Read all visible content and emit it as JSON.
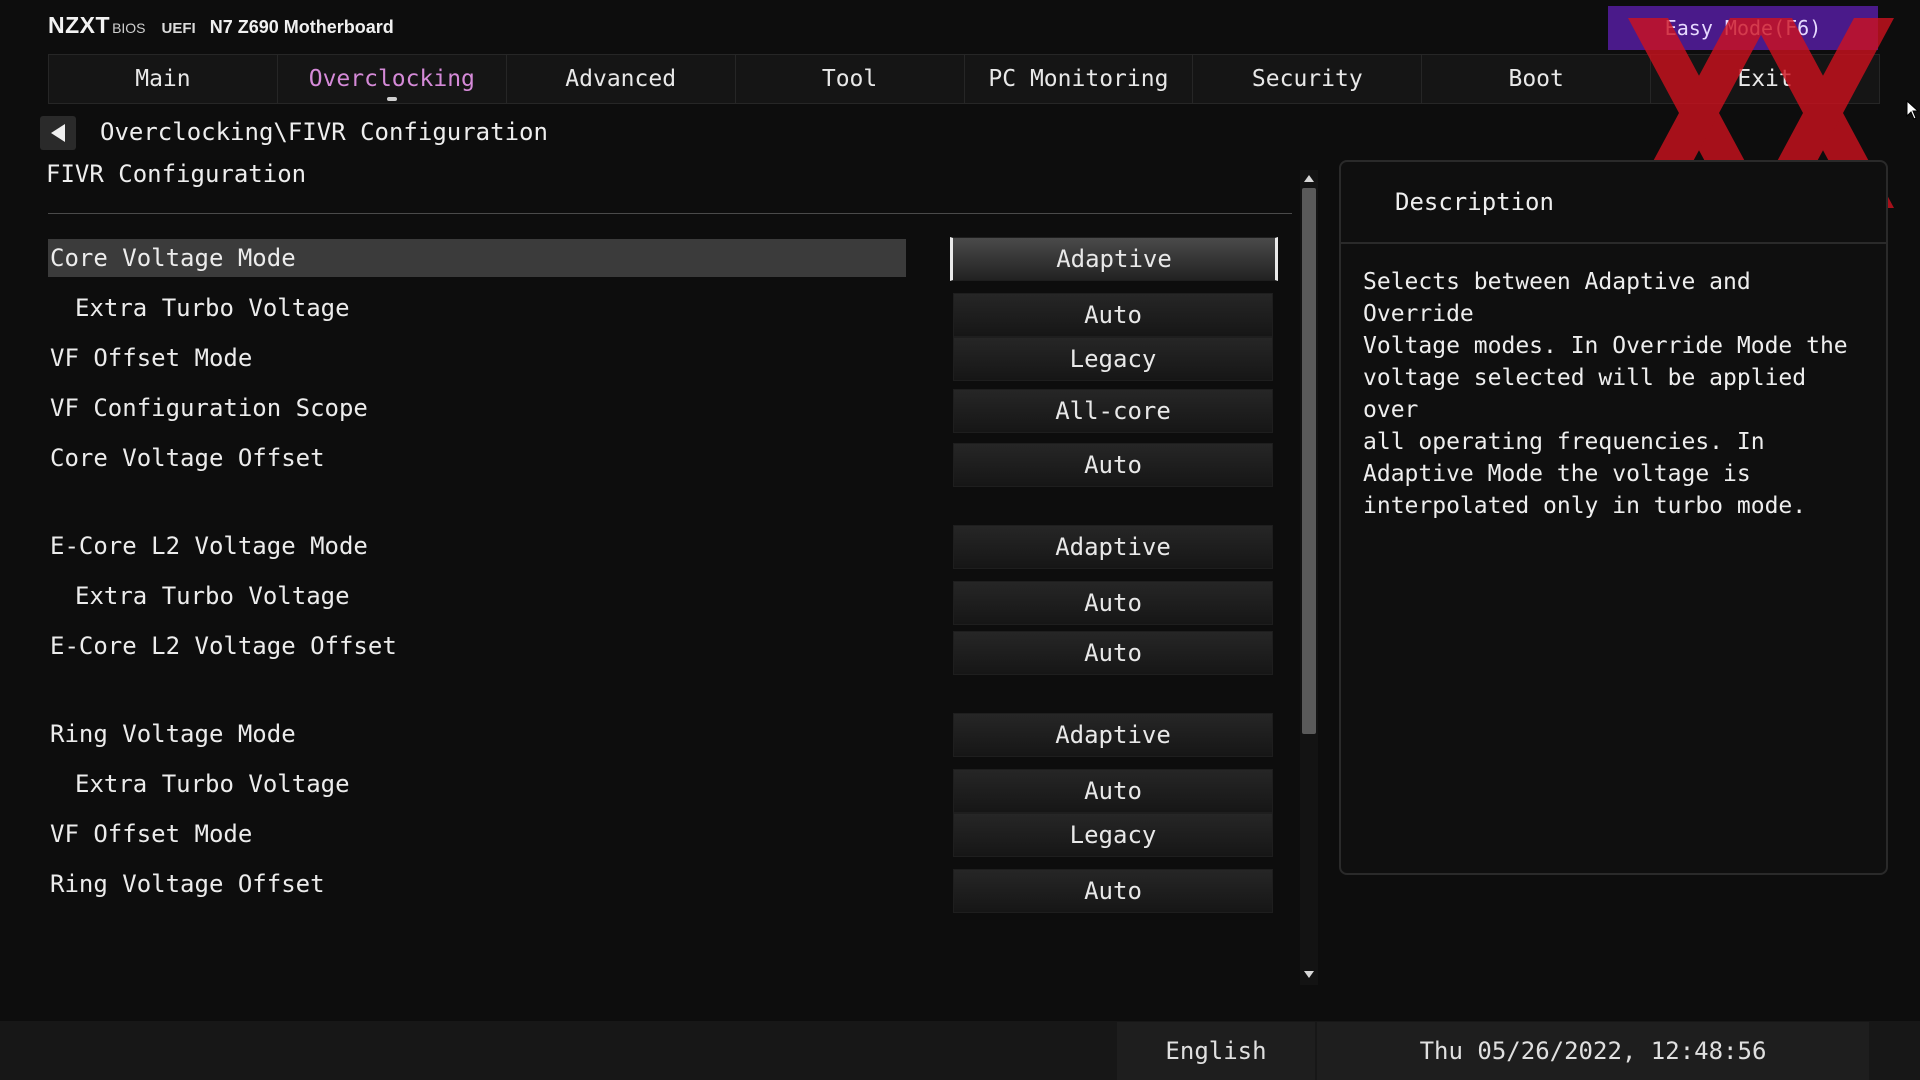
{
  "header": {
    "logo": "NZXT",
    "bios": "BIOS",
    "uefi": "UEFI",
    "board": "N7 Z690 Motherboard",
    "easy_mode": "Easy Mode(F6)"
  },
  "tabs": [
    {
      "label": "Main"
    },
    {
      "label": "Overclocking",
      "active": true
    },
    {
      "label": "Advanced"
    },
    {
      "label": "Tool"
    },
    {
      "label": "PC Monitoring"
    },
    {
      "label": "Security"
    },
    {
      "label": "Boot"
    },
    {
      "label": "Exit"
    }
  ],
  "breadcrumb": "Overclocking\\FIVR Configuration",
  "section_title": "FIVR Configuration",
  "settings": [
    {
      "label": "Core Voltage Mode",
      "value": "Adaptive",
      "selected": true,
      "indent": false
    },
    {
      "label": "Extra Turbo Voltage",
      "value": "Auto",
      "selected": false,
      "indent": true
    },
    {
      "label": "VF Offset Mode",
      "value": "Legacy",
      "selected": false,
      "indent": false
    },
    {
      "label": "VF Configuration Scope",
      "value": "All-core",
      "selected": false,
      "indent": false
    },
    {
      "label": "Core Voltage Offset",
      "value": "Auto",
      "selected": false,
      "indent": false
    },
    {
      "label": "E-Core L2 Voltage Mode",
      "value": "Adaptive",
      "selected": false,
      "indent": false
    },
    {
      "label": "Extra Turbo Voltage",
      "value": "Auto",
      "selected": false,
      "indent": true
    },
    {
      "label": "E-Core L2 Voltage Offset",
      "value": "Auto",
      "selected": false,
      "indent": false
    },
    {
      "label": "Ring Voltage Mode",
      "value": "Adaptive",
      "selected": false,
      "indent": false
    },
    {
      "label": "Extra Turbo Voltage",
      "value": "Auto",
      "selected": false,
      "indent": true
    },
    {
      "label": "VF Offset Mode",
      "value": "Legacy",
      "selected": false,
      "indent": false
    },
    {
      "label": "Ring Voltage Offset",
      "value": "Auto",
      "selected": false,
      "indent": false
    }
  ],
  "description": {
    "title": "Description",
    "text": "Selects between Adaptive and Override\nVoltage modes. In Override Mode the\nvoltage selected will be applied over\nall operating frequencies. In\nAdaptive Mode the voltage is\ninterpolated only in turbo mode."
  },
  "footer": {
    "language": "English",
    "datetime": "Thu 05/26/2022, 12:48:56"
  },
  "colors": {
    "active_tab": "#d58ad8",
    "easy_mode_bg": "#4a1a8a",
    "watermark": "#d0121e"
  }
}
